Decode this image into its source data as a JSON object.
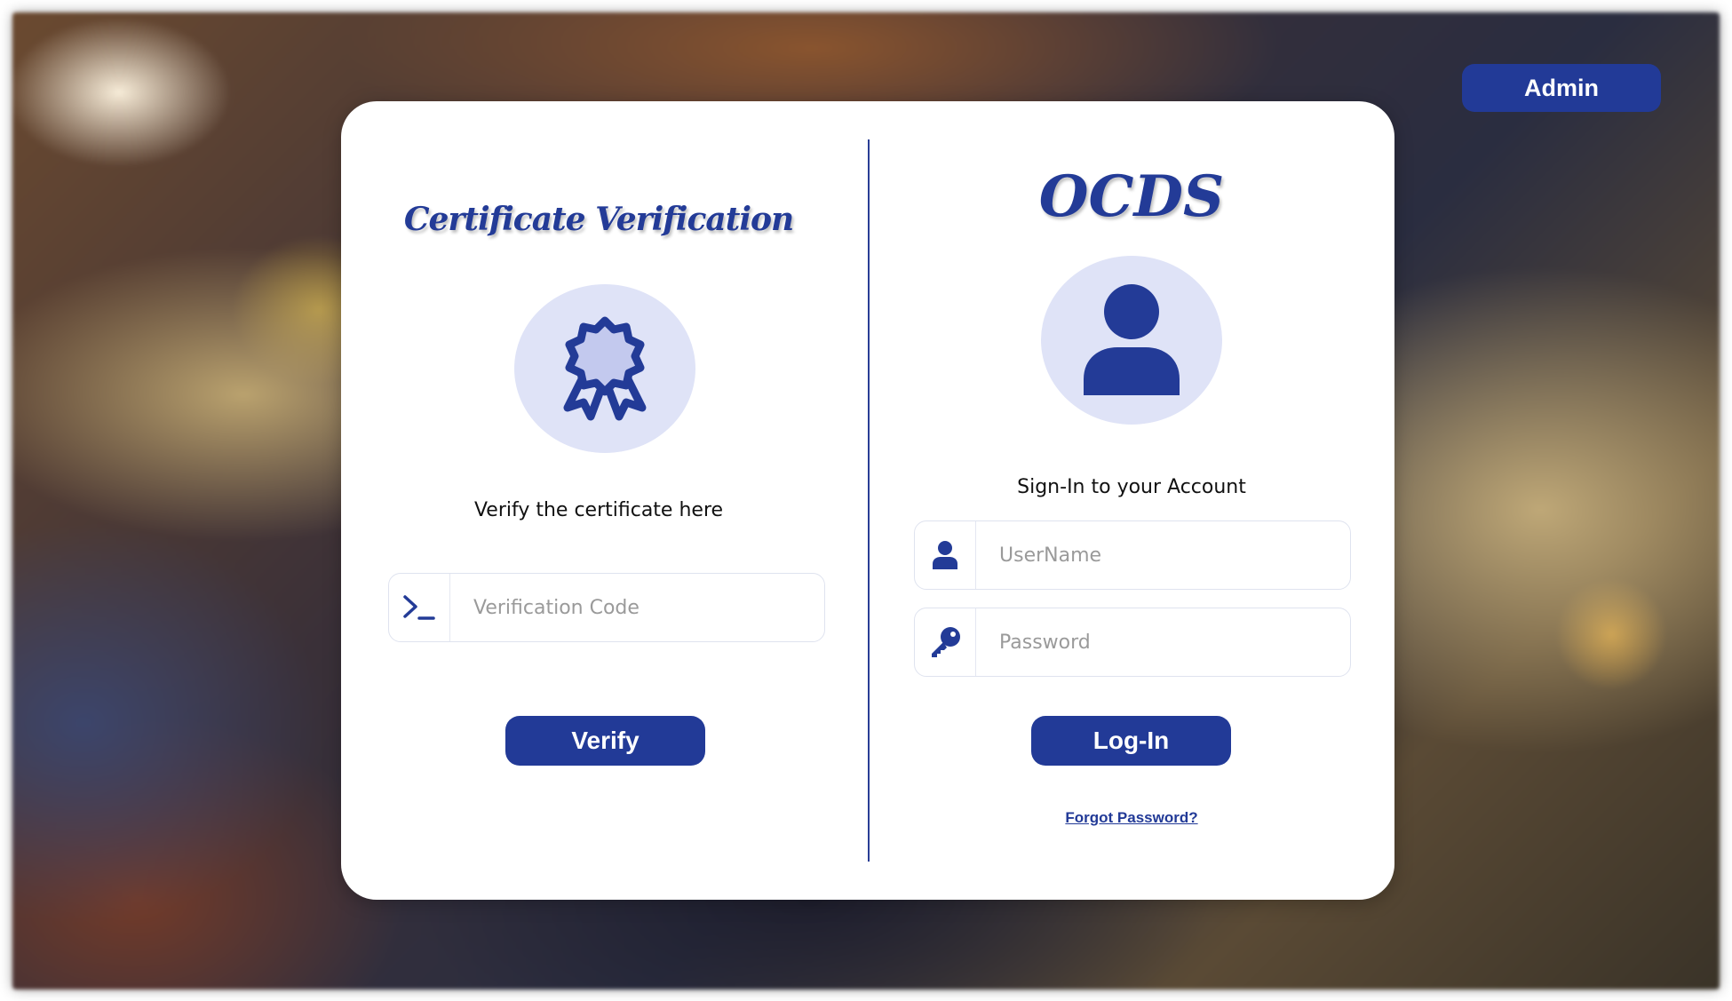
{
  "header": {
    "admin_label": "Admin"
  },
  "verification": {
    "title": "Certificate Verification",
    "icon": "award-ribbon-icon",
    "caption": "Verify the certificate here",
    "code_placeholder": "Verification Code",
    "code_icon": "terminal-prompt-icon",
    "button_label": "Verify"
  },
  "login": {
    "title": "OCDS",
    "icon": "user-avatar-icon",
    "caption": "Sign-In to your Account",
    "username_placeholder": "UserName",
    "username_icon": "user-icon",
    "password_placeholder": "Password",
    "password_icon": "key-icon",
    "button_label": "Log-In",
    "forgot_label": "Forgot Password?"
  },
  "colors": {
    "accent": "#223a97",
    "icon_circle": "#dfe3f7",
    "card": "#ffffff"
  }
}
